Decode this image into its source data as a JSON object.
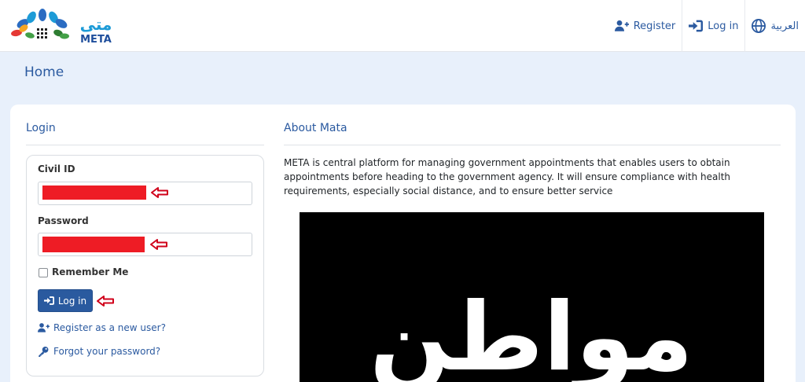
{
  "navbar": {
    "logo_text_latin": "META",
    "logo_text_arabic": "متى",
    "links": [
      {
        "label": "Register",
        "icon": "user-plus-icon"
      },
      {
        "label": "Log in",
        "icon": "sign-in-icon"
      },
      {
        "label": "العربية",
        "icon": "globe-icon"
      }
    ]
  },
  "header": {
    "title": "Home"
  },
  "login": {
    "title": "Login",
    "civil_id_label": "Civil ID",
    "password_label": "Password",
    "remember_me_label": "Remember Me",
    "login_button": "Log in",
    "register_link": "Register as a new user?",
    "forgot_link": "Forgot your password?"
  },
  "about": {
    "title": "About Mata",
    "text": "META is central platform for managing government appointments that enables users to obtain appointments before heading to the government agency. It will ensure compliance with health requirements, especially social distance, and to ensure better service",
    "video_text": "مواطن"
  },
  "colors": {
    "primary": "#2a5a9f",
    "background": "#e8f0fb",
    "redaction": "#ee1c25",
    "annotation_arrow": "#d0021b"
  }
}
